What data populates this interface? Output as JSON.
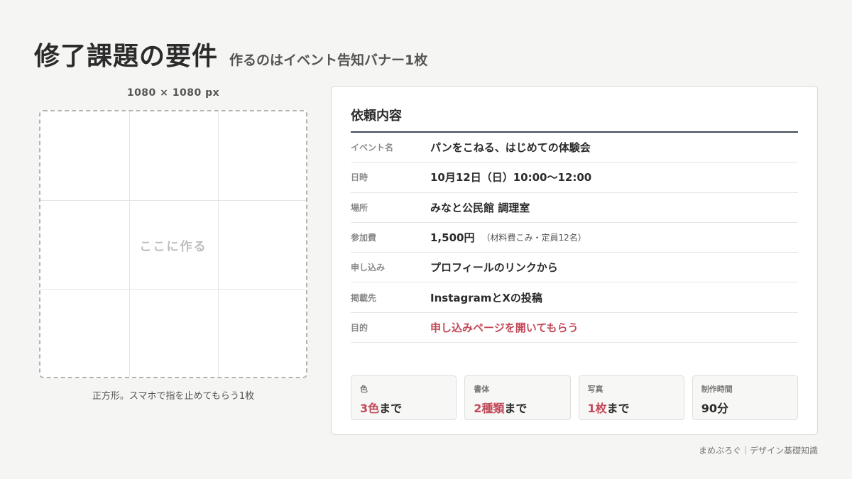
{
  "header": {
    "title": "修了課題の要件",
    "subtitle": "作るのはイベント告知バナー1枚"
  },
  "canvas": {
    "size_label": "1080 × 1080 px",
    "center_text": "ここに作る",
    "caption": "正方形。スマホで指を止めてもらう1枚"
  },
  "card": {
    "title": "依頼内容",
    "rows": [
      {
        "key": "イベント名",
        "value": "パンをこねる、はじめての体験会",
        "note": ""
      },
      {
        "key": "日時",
        "value": "10月12日（日）10:00〜12:00",
        "note": ""
      },
      {
        "key": "場所",
        "value": "みなと公民館 調理室",
        "note": ""
      },
      {
        "key": "参加費",
        "value": "1,500円",
        "note": "（材料費こみ・定員12名）"
      },
      {
        "key": "申し込み",
        "value": "プロフィールのリンクから",
        "note": ""
      },
      {
        "key": "掲載先",
        "value": "InstagramとXの投稿",
        "note": ""
      },
      {
        "key": "目的",
        "value": "申し込みページを開いてもらう",
        "note": ""
      }
    ],
    "accent_color": "#c24a5a",
    "rule_color": "#3c4a57"
  },
  "stats": [
    {
      "label": "色",
      "value_highlight": "3色",
      "value_rest": "まで"
    },
    {
      "label": "書体",
      "value_highlight": "2種類",
      "value_rest": "まで"
    },
    {
      "label": "写真",
      "value_highlight": "1枚",
      "value_rest": "まで"
    },
    {
      "label": "制作時間",
      "value_highlight": "",
      "value_rest": "90分"
    }
  ],
  "footer": "まめぶろぐ｜デザイン基礎知識"
}
